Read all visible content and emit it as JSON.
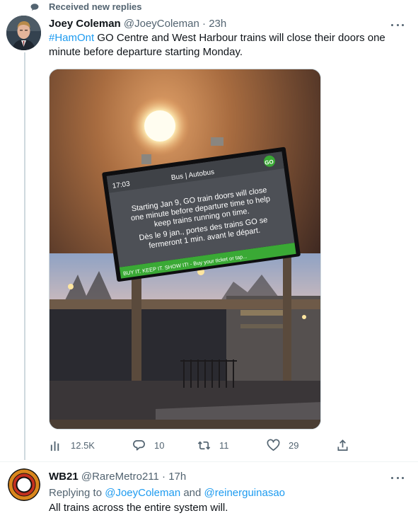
{
  "notice": {
    "text": "Received new replies"
  },
  "tweet": {
    "author_name": "Joey Coleman",
    "author_handle": "@JoeyColeman",
    "separator": " · ",
    "time": "23h",
    "hashtag": "#HamOnt",
    "body": " GO Centre and West Harbour trains will close their doors one minute before departure starting Monday.",
    "image": {
      "sign_time": "17:03",
      "sign_header": "Bus | Autobus",
      "sign_lines": [
        "Starting Jan 9, GO train doors will close",
        "one minute before departure time to help",
        "keep trains running on time.",
        "Dès le 9 jan., portes des trains GO se",
        "fermeront 1 min. avant le départ."
      ],
      "sign_ticker": "BUY IT. KEEP IT. SHOW IT! - Buy your ticket or tap...",
      "sign_logo": "GO"
    },
    "stats": {
      "views": "12.5K",
      "replies": "10",
      "retweets": "11",
      "likes": "29"
    }
  },
  "reply": {
    "author_name": "WB21",
    "author_handle": "@RareMetro211",
    "separator": " · ",
    "time": "17h",
    "replying_prefix": "Replying to ",
    "mention_1": "@JoeyColeman",
    "and_word": " and ",
    "mention_2": "@reinerguinasao",
    "text": "All trains across the entire system will."
  },
  "icons": {
    "notice": "speech-bubble-icon",
    "more": "more-dots-icon",
    "views": "analytics-bars-icon",
    "reply": "reply-bubble-icon",
    "retweet": "retweet-icon",
    "like": "heart-icon",
    "share": "share-icon"
  },
  "colors": {
    "link": "#1d9bf0",
    "muted": "#536471",
    "text": "#0f1419",
    "sign_green": "#3aa935"
  }
}
